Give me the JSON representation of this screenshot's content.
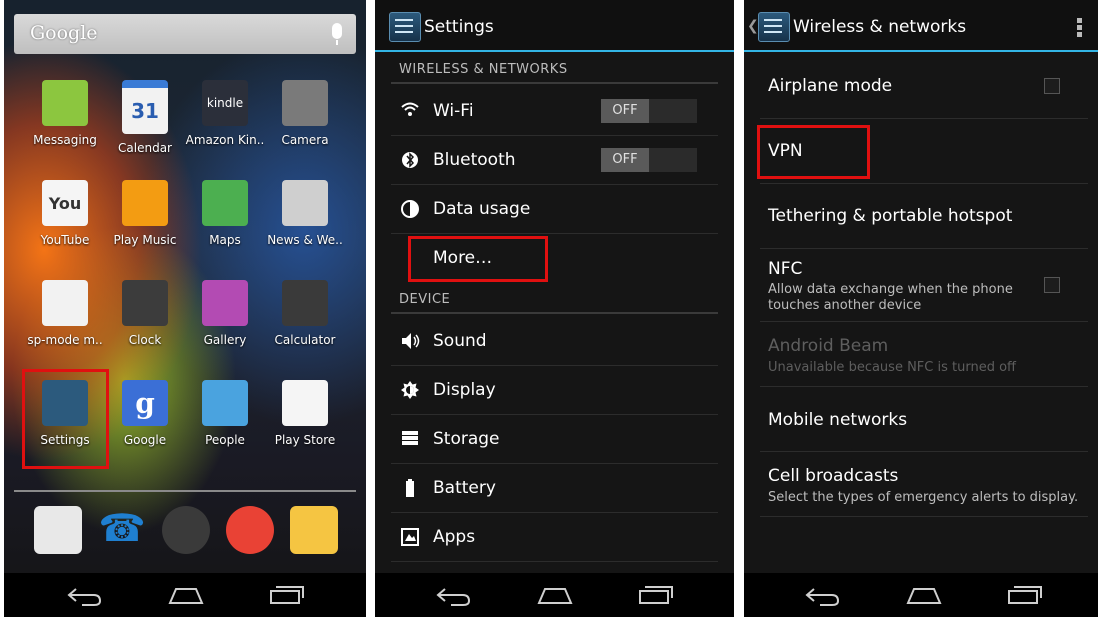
{
  "home": {
    "search_label": "Google",
    "apps": [
      {
        "label": "Messaging",
        "icon": "messaging-icon",
        "color": "#8cc63f"
      },
      {
        "label": "Calendar",
        "icon": "calendar-icon",
        "color": "#3a7bd5",
        "glyph": "31"
      },
      {
        "label": "Amazon Kin..",
        "icon": "kindle-icon",
        "color": "#2b2f3a",
        "glyph": "kindle"
      },
      {
        "label": "Camera",
        "icon": "camera-icon",
        "color": "#7a7a7a"
      },
      {
        "label": "YouTube",
        "icon": "youtube-icon",
        "color": "#e33b2e",
        "glyph": "You"
      },
      {
        "label": "Play Music",
        "icon": "headphones-icon",
        "color": "#f39c12"
      },
      {
        "label": "Maps",
        "icon": "maps-icon",
        "color": "#4caf50"
      },
      {
        "label": "News & We..",
        "icon": "news-weather-icon",
        "color": "#cfcfcf"
      },
      {
        "label": "sp-mode m..",
        "icon": "sp-mode-mail-icon",
        "color": "#f2f2f2"
      },
      {
        "label": "Clock",
        "icon": "clock-icon",
        "color": "#3c3c3c"
      },
      {
        "label": "Gallery",
        "icon": "gallery-icon",
        "color": "#b34bb3"
      },
      {
        "label": "Calculator",
        "icon": "calculator-icon",
        "color": "#3a3a3a"
      },
      {
        "label": "Settings",
        "icon": "settings-icon",
        "color": "#2c5a7d"
      },
      {
        "label": "Google",
        "icon": "google-search-icon",
        "color": "#3b6fd6",
        "glyph": "g"
      },
      {
        "label": "People",
        "icon": "people-icon",
        "color": "#4aa3df"
      },
      {
        "label": "Play Store",
        "icon": "play-store-icon",
        "color": "#f5f5f5"
      }
    ],
    "dock": [
      {
        "icon": "gmail-icon",
        "color": "#e8e8e8"
      },
      {
        "icon": "phone-icon",
        "color": "#1f7fd0"
      },
      {
        "icon": "app-drawer-icon",
        "color": "#3a3a3a"
      },
      {
        "icon": "chrome-icon",
        "color": "#e94235"
      },
      {
        "icon": "email-icon",
        "color": "#f5c542"
      }
    ]
  },
  "settings": {
    "title": "Settings",
    "section_wireless": "WIRELESS & NETWORKS",
    "wifi_label": "Wi-Fi",
    "wifi_state": "OFF",
    "bluetooth_label": "Bluetooth",
    "bluetooth_state": "OFF",
    "data_usage_label": "Data usage",
    "more_label": "More…",
    "section_device": "DEVICE",
    "sound_label": "Sound",
    "display_label": "Display",
    "storage_label": "Storage",
    "battery_label": "Battery",
    "apps_label": "Apps"
  },
  "wireless": {
    "title": "Wireless & networks",
    "airplane_label": "Airplane mode",
    "vpn_label": "VPN",
    "tethering_label": "Tethering & portable hotspot",
    "nfc_label": "NFC",
    "nfc_summary_1": "Allow data exchange when the phone",
    "nfc_summary_2": "touches another device",
    "beam_label": "Android Beam",
    "beam_summary": "Unavailable because NFC is turned off",
    "mobile_label": "Mobile networks",
    "cell_label": "Cell broadcasts",
    "cell_summary": "Select the types of emergency alerts to display."
  },
  "colors": {
    "accent": "#33b5e5",
    "highlight": "#e01010"
  }
}
